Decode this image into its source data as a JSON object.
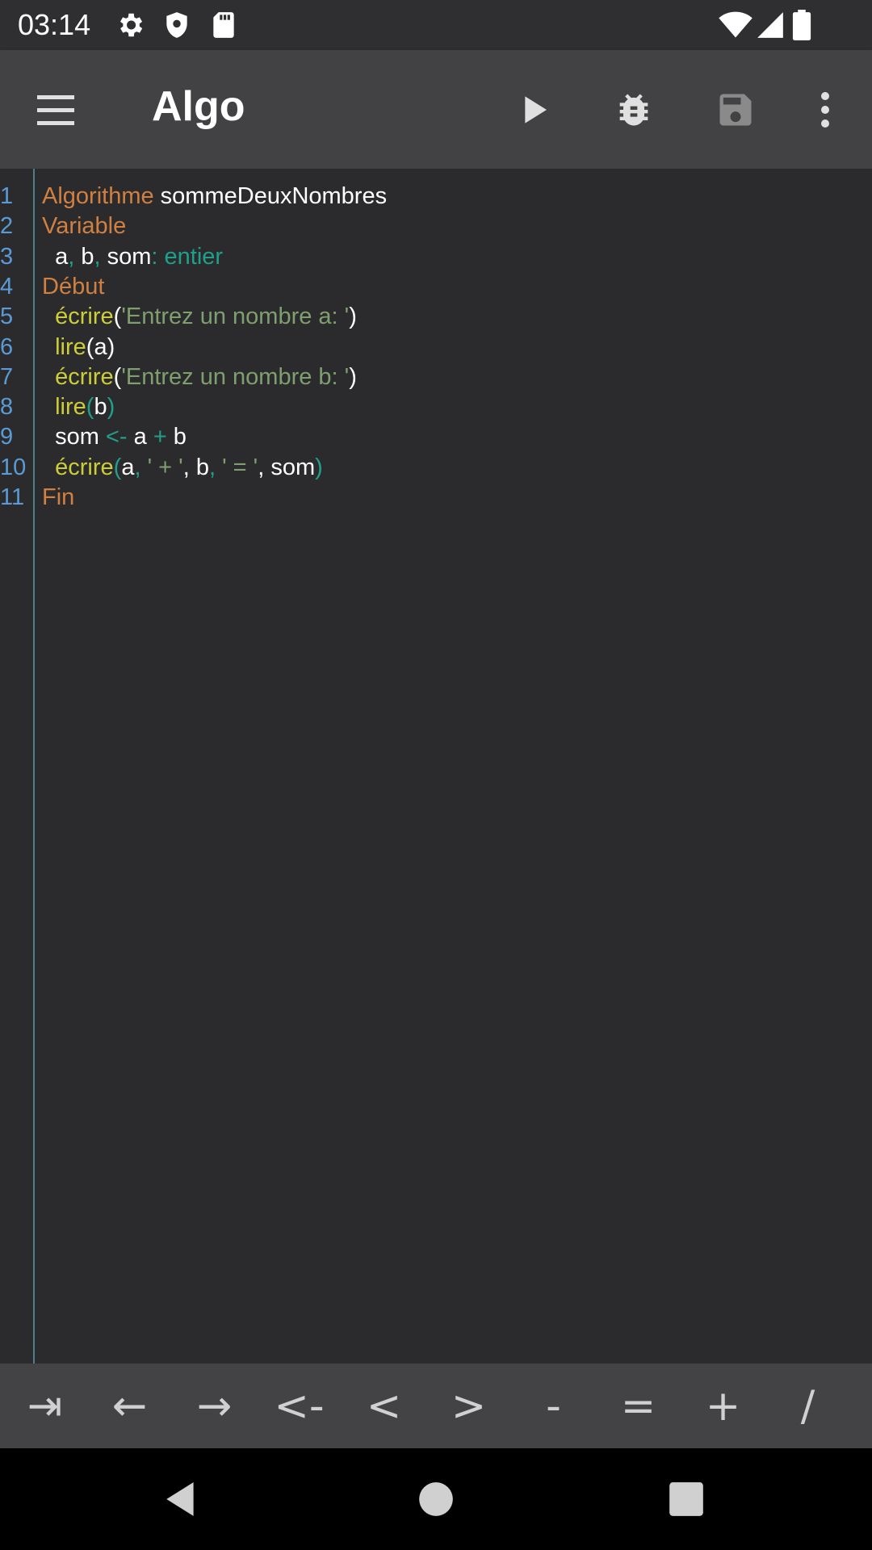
{
  "status": {
    "time": "03:14",
    "icons_left": [
      "gear-icon",
      "shield-icon",
      "sdcard-icon"
    ],
    "icons_right": [
      "wifi-icon",
      "signal-icon",
      "battery-icon"
    ]
  },
  "appbar": {
    "title": "Algo",
    "actions": [
      "run-icon",
      "debug-icon",
      "save-icon",
      "more-icon"
    ]
  },
  "editor": {
    "lines": [
      {
        "num": "1",
        "tokens": [
          [
            "kw",
            "Algorithme"
          ],
          [
            "plain",
            " sommeDeuxNombres"
          ]
        ]
      },
      {
        "num": "2",
        "tokens": [
          [
            "kw",
            "Variable"
          ]
        ]
      },
      {
        "num": "3",
        "tokens": [
          [
            "plain",
            "  a"
          ],
          [
            "op",
            ","
          ],
          [
            "plain",
            " b"
          ],
          [
            "op",
            ","
          ],
          [
            "plain",
            " som"
          ],
          [
            "op",
            ": "
          ],
          [
            "typ",
            "entier"
          ]
        ]
      },
      {
        "num": "4",
        "tokens": [
          [
            "kw",
            "Début"
          ]
        ]
      },
      {
        "num": "5",
        "tokens": [
          [
            "fn",
            "  écrire"
          ],
          [
            "plain",
            "("
          ],
          [
            "str",
            "'Entrez un nombre a: '"
          ],
          [
            "plain",
            ")"
          ]
        ]
      },
      {
        "num": "6",
        "tokens": [
          [
            "fn",
            "  lire"
          ],
          [
            "plain",
            "(a)"
          ]
        ]
      },
      {
        "num": "7",
        "tokens": [
          [
            "fn",
            "  écrire"
          ],
          [
            "plain",
            "("
          ],
          [
            "str",
            "'Entrez un nombre b: '"
          ],
          [
            "plain",
            ")"
          ]
        ]
      },
      {
        "num": "8",
        "tokens": [
          [
            "fn",
            "  lire"
          ],
          [
            "op",
            "("
          ],
          [
            "plain",
            "b"
          ],
          [
            "op",
            ")"
          ]
        ]
      },
      {
        "num": "9",
        "tokens": [
          [
            "plain",
            "  som "
          ],
          [
            "op",
            "<-"
          ],
          [
            "plain",
            " a "
          ],
          [
            "op",
            "+"
          ],
          [
            "plain",
            " b"
          ]
        ]
      },
      {
        "num": "10",
        "tokens": [
          [
            "fn",
            "  écrire"
          ],
          [
            "op",
            "("
          ],
          [
            "plain",
            "a"
          ],
          [
            "op",
            ", "
          ],
          [
            "str",
            "' + '"
          ],
          [
            "plain",
            ", b"
          ],
          [
            "op",
            ", "
          ],
          [
            "str",
            "' = '"
          ],
          [
            "plain",
            ", som"
          ],
          [
            "op",
            ")"
          ]
        ]
      },
      {
        "num": "11",
        "tokens": [
          [
            "kw",
            "Fin"
          ]
        ]
      }
    ]
  },
  "keybar": {
    "keys": [
      "⇥",
      "←",
      "→",
      "<-",
      "<",
      ">",
      "-",
      "=",
      "+",
      "/"
    ]
  },
  "nav": [
    "back-icon",
    "home-icon",
    "recents-icon"
  ]
}
